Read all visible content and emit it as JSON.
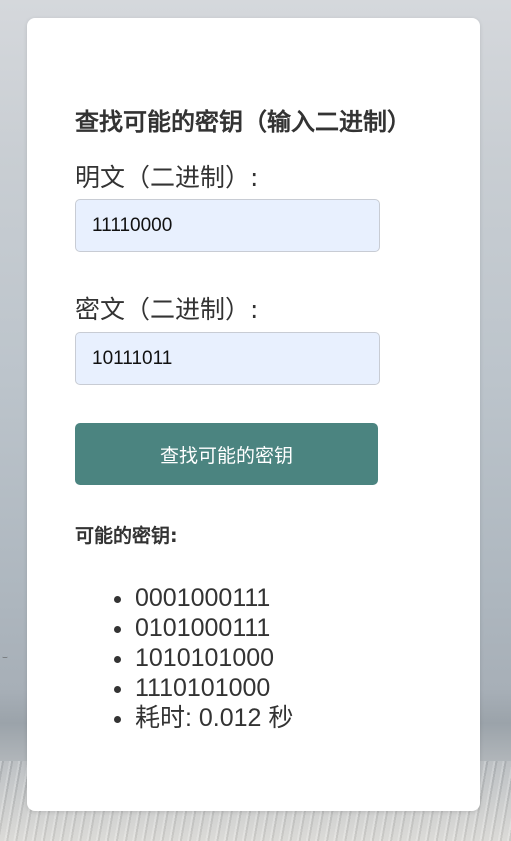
{
  "form": {
    "title": "查找可能的密钥（输入二进制）",
    "plaintext_label": "明文（二进制）:",
    "plaintext_value": "11110000",
    "ciphertext_label": "密文（二进制）:",
    "ciphertext_value": "10111011",
    "submit_label": "查找可能的密钥"
  },
  "results": {
    "heading": "可能的密钥:",
    "keys": [
      "0001000111",
      "0101000111",
      "1010101000",
      "1110101000"
    ],
    "elapsed": "耗时: 0.012 秒"
  },
  "colors": {
    "button_background": "#4b8480",
    "input_background": "#e8f0fe",
    "card_background": "#ffffff",
    "text": "#333333"
  }
}
